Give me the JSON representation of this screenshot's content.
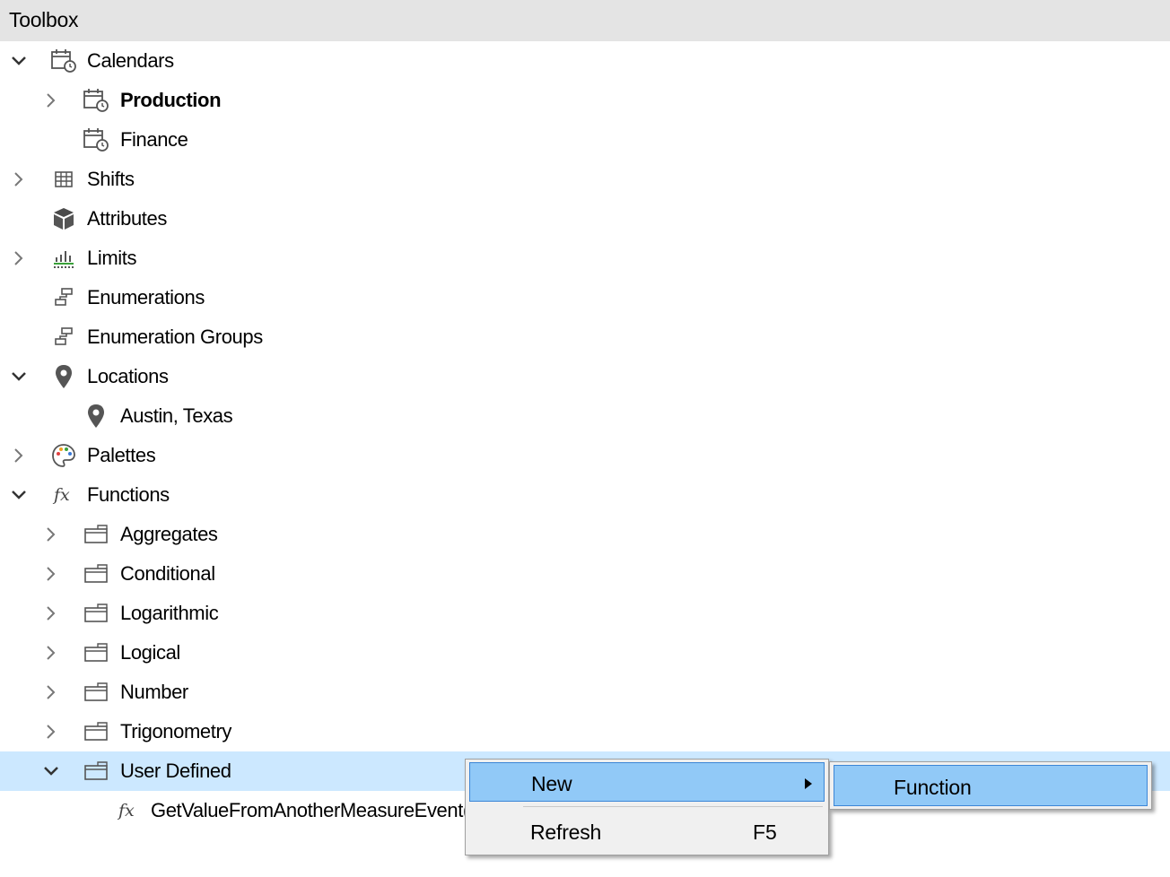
{
  "panel": {
    "title": "Toolbox"
  },
  "tree": {
    "calendars": "Calendars",
    "production": "Production",
    "finance": "Finance",
    "shifts": "Shifts",
    "attributes": "Attributes",
    "limits": "Limits",
    "enumerations": "Enumerations",
    "enumeration_groups": "Enumeration Groups",
    "locations": "Locations",
    "austin": "Austin, Texas",
    "palettes": "Palettes",
    "functions": "Functions",
    "aggregates": "Aggregates",
    "conditional": "Conditional",
    "logarithmic": "Logarithmic",
    "logical": "Logical",
    "number": "Number",
    "trigonometry": "Trigonometry",
    "user_defined": "User Defined",
    "get_value": "GetValueFromAnotherMeasureEvent("
  },
  "context_menu": {
    "new_label": "New",
    "refresh_label": "Refresh",
    "refresh_shortcut": "F5"
  },
  "submenu": {
    "function_label": "Function"
  },
  "colors": {
    "title_bar": "#e4e4e4",
    "selected_row": "#cce8ff",
    "menu_highlight": "#91c9f7",
    "menu_highlight_border": "#3c86d6",
    "icon_gray": "#555555",
    "limits_green": "#3aa13a"
  }
}
